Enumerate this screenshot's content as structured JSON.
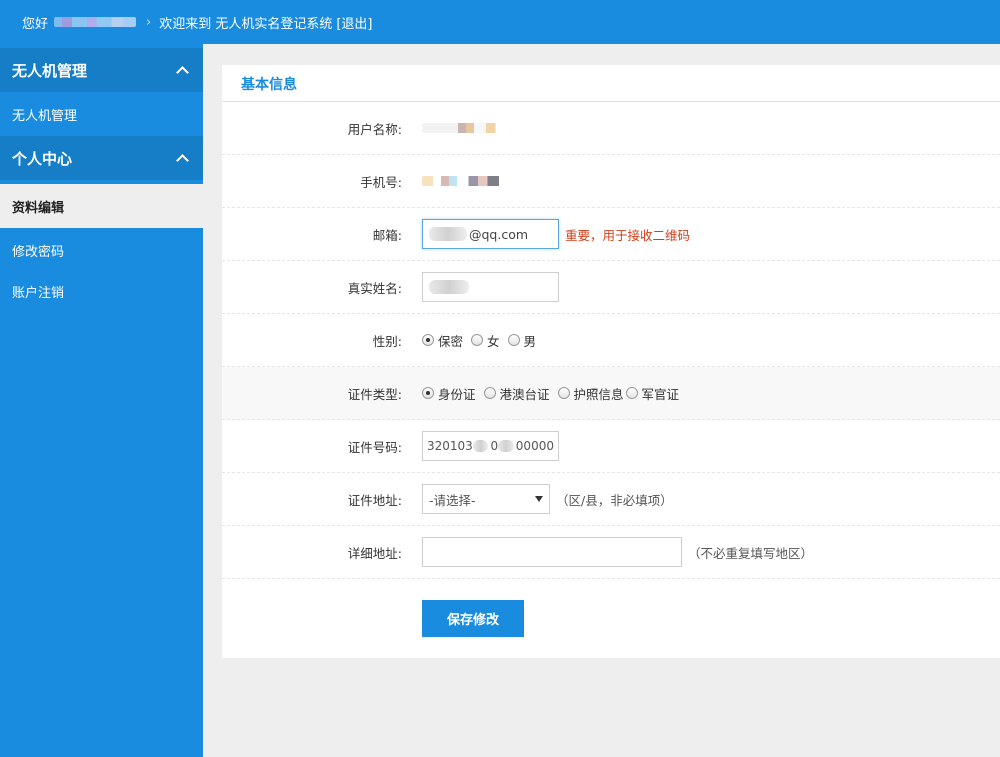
{
  "header": {
    "greeting": "您好",
    "welcome": "欢迎来到 无人机实名登记系统",
    "logout": "[退出]",
    "separator": "›"
  },
  "sidebar": {
    "groups": [
      {
        "title": "无人机管理",
        "items": [
          "无人机管理"
        ]
      },
      {
        "title": "个人中心",
        "items": [
          "资料编辑",
          "修改密码",
          "账户注销"
        ]
      }
    ],
    "active_item": "资料编辑"
  },
  "panel": {
    "title": "基本信息",
    "username_label": "用户名称:",
    "phone_label": "手机号:",
    "email_label": "邮箱:",
    "email_suffix": "@qq.com",
    "email_hint": "重要，用于接收二维码",
    "realname_label": "真实姓名:",
    "gender_label": "性别:",
    "gender_options": [
      "保密",
      "女",
      "男"
    ],
    "gender_selected": "保密",
    "idtype_label": "证件类型:",
    "idtype_options": [
      "身份证",
      "港澳台证",
      "护照信息",
      "军官证"
    ],
    "idtype_selected": "身份证",
    "idno_label": "证件号码:",
    "idno_prefix": "320103",
    "idno_mid": "0",
    "idno_suffix": "00000",
    "address_label": "证件地址:",
    "address_select": "-请选择-",
    "address_hint": "（区/县，非必填项）",
    "detail_label": "详细地址:",
    "detail_value": "",
    "detail_hint": "（不必重复填写地区）",
    "save_button": "保存修改"
  },
  "colors": {
    "brand": "#1a8ce0",
    "sidebar_head": "#167dc7",
    "warning_text": "#d43f1a"
  },
  "icons": {
    "menu_collapse": "chevron-up-icon",
    "select_caret": "caret-down-icon"
  }
}
